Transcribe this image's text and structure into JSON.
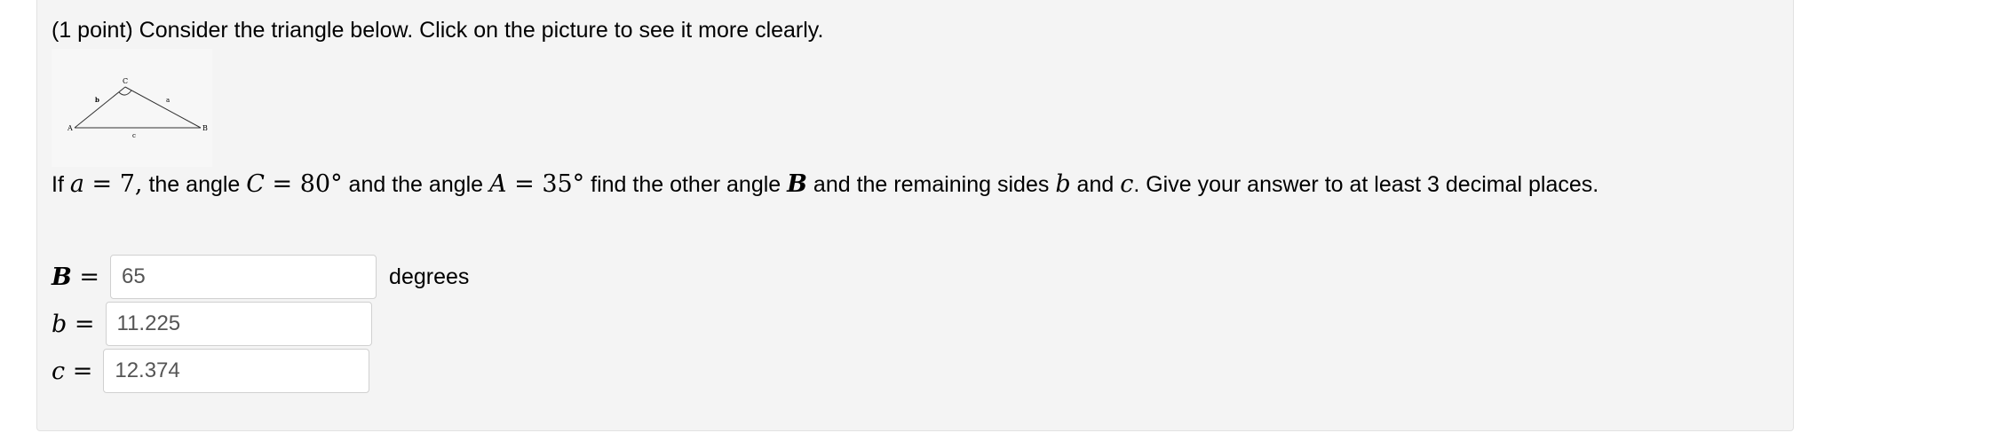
{
  "problem": {
    "intro": "(1 point) Consider the triangle below. Click on the picture to see it more clearly.",
    "figure_labels": {
      "A": "A",
      "B": "B",
      "C": "C",
      "a": "a",
      "b": "b",
      "c": "c"
    },
    "question": {
      "p1": "If ",
      "m1_var": "a",
      "m1_rest": " = 7,",
      "p2": " the angle ",
      "m2_var": "C",
      "m2_rest": " = 80°",
      "p3": " and the angle ",
      "m3_var": "A",
      "m3_rest": " = 35°",
      "p4": " find the other angle ",
      "m4_var": "B",
      "p5": " and the remaining sides ",
      "m5_var": "b",
      "p6": " and ",
      "m6_var": "c",
      "p7": ". Give your answer to at least 3 decimal places."
    },
    "answers": [
      {
        "var": "B",
        "eq": " =",
        "value": "65",
        "unit": "degrees"
      },
      {
        "var": "b",
        "eq": " =",
        "value": "11.225",
        "unit": ""
      },
      {
        "var": "c",
        "eq": " =",
        "value": "12.374",
        "unit": ""
      }
    ]
  }
}
